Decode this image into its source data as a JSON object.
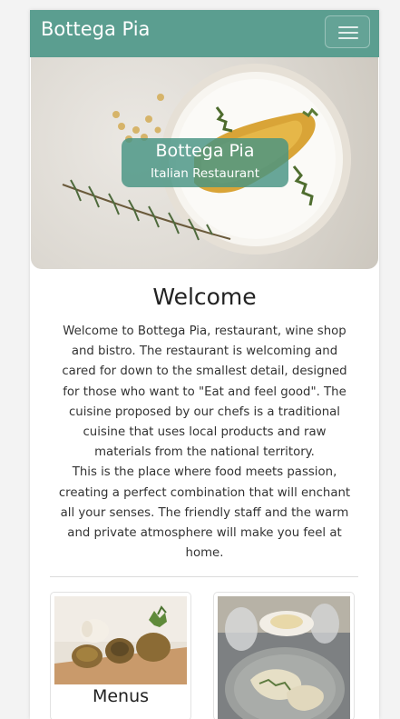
{
  "navbar": {
    "brand": "Bottega Pia",
    "toggler_icon": "hamburger-menu-icon"
  },
  "hero": {
    "title": "Bottega Pia",
    "subtitle": "Italian Restaurant"
  },
  "welcome": {
    "title": "Welcome",
    "lines": [
      "Welcome to Bottega Pia, restaurant, wine shop",
      "and bistro. The restaurant is welcoming and",
      "cared for down to the smallest detail, designed",
      "for those who want to \"Eat and feel good\". The",
      "cuisine proposed by our chefs is a traditional",
      "cuisine that uses local products and raw",
      "materials from the national territory.",
      "This is the place where food meets passion,",
      "creating a perfect combination that will enchant",
      "all your senses. The friendly staff and the warm",
      "and private atmosphere will make you feel at",
      "home."
    ]
  },
  "cards": [
    {
      "label": "Menus"
    },
    {
      "label": ""
    }
  ],
  "colors": {
    "navbar": "#5b9e90",
    "caption_overlay": "#479483",
    "page_background": "#f3f3f3"
  }
}
